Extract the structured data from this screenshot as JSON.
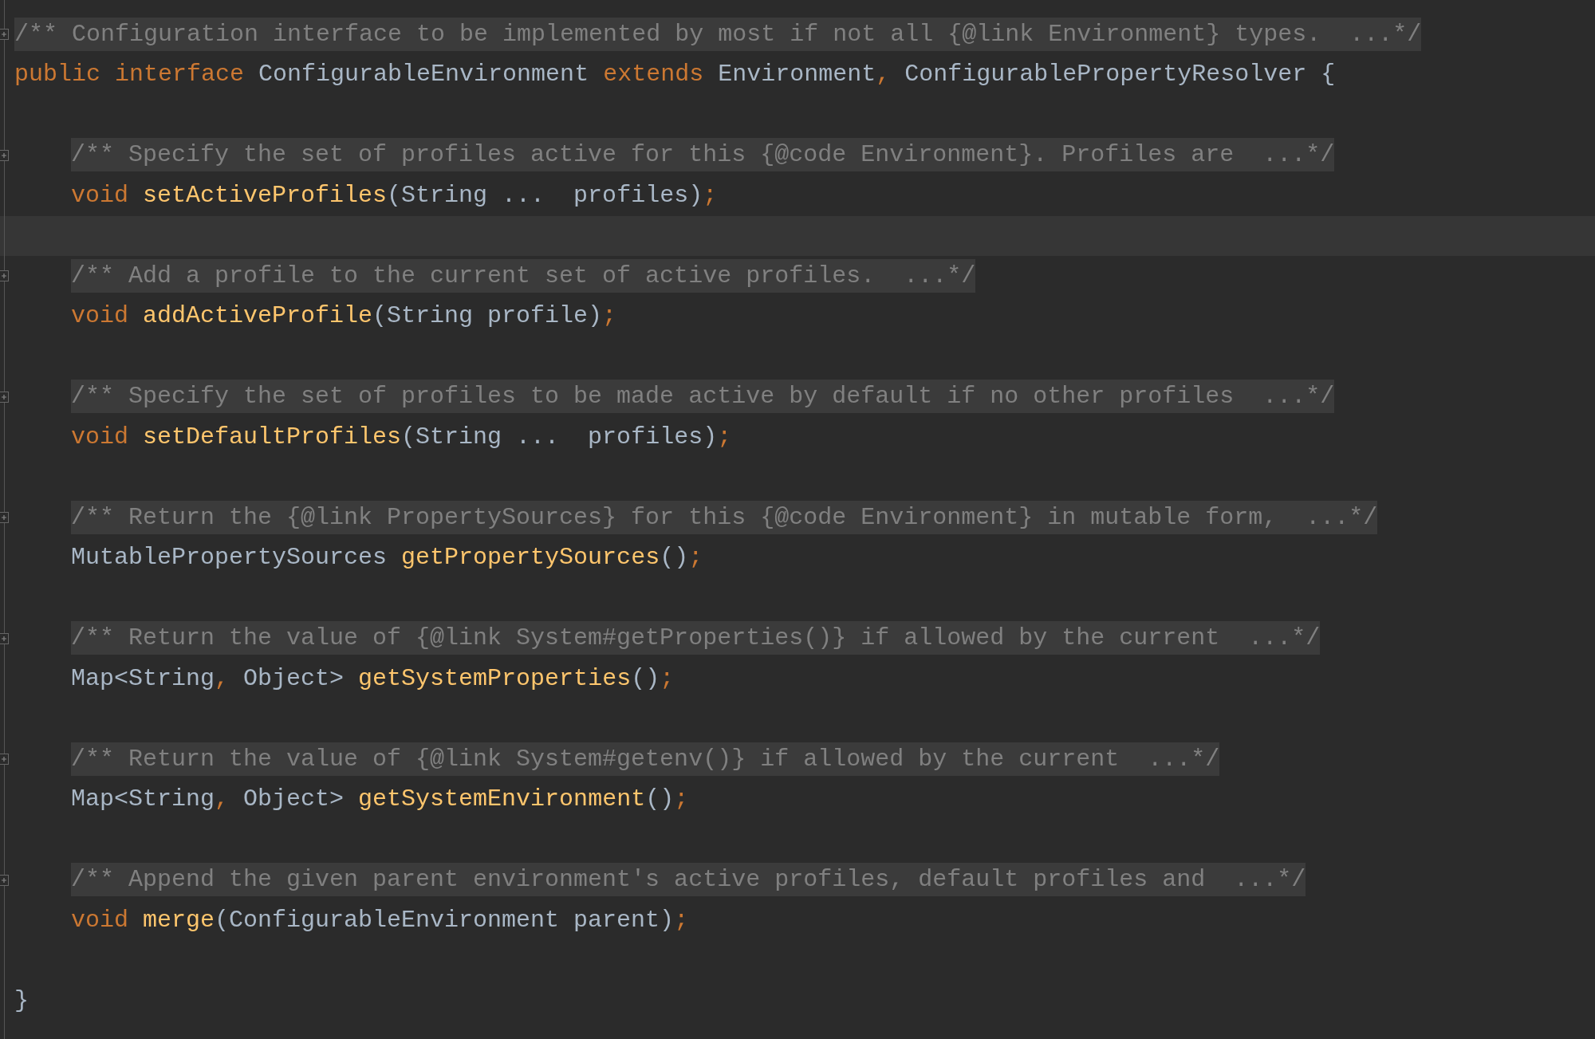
{
  "editor": {
    "header_comment": {
      "text": "/** Configuration interface to be implemented by most if not all {@link Environment} types.  ...*/",
      "folded": true
    },
    "declaration": [
      {
        "kind": "keyword",
        "text": "public interface "
      },
      {
        "kind": "plain",
        "text": "ConfigurableEnvironment "
      },
      {
        "kind": "keyword",
        "text": "extends "
      },
      {
        "kind": "plain",
        "text": "Environment"
      },
      {
        "kind": "punct",
        "text": ", "
      },
      {
        "kind": "plain",
        "text": "ConfigurablePropertyResolver {"
      }
    ],
    "members": [
      {
        "comment": {
          "text": "/** Specify the set of profiles active for this {@code Environment}. Profiles are  ...*/",
          "folded": true
        },
        "signature": [
          {
            "kind": "keyword",
            "text": "void "
          },
          {
            "kind": "method",
            "text": "setActiveProfiles"
          },
          {
            "kind": "plain",
            "text": "(String ...  profiles)"
          },
          {
            "kind": "punct",
            "text": ";"
          }
        ],
        "caret_line_after": true
      },
      {
        "comment": {
          "text": "/** Add a profile to the current set of active profiles.  ...*/",
          "folded": true
        },
        "signature": [
          {
            "kind": "keyword",
            "text": "void "
          },
          {
            "kind": "method",
            "text": "addActiveProfile"
          },
          {
            "kind": "plain",
            "text": "(String profile)"
          },
          {
            "kind": "punct",
            "text": ";"
          }
        ],
        "caret_line_after": false
      },
      {
        "comment": {
          "text": "/** Specify the set of profiles to be made active by default if no other profiles  ...*/",
          "folded": true
        },
        "signature": [
          {
            "kind": "keyword",
            "text": "void "
          },
          {
            "kind": "method",
            "text": "setDefaultProfiles"
          },
          {
            "kind": "plain",
            "text": "(String ...  profiles)"
          },
          {
            "kind": "punct",
            "text": ";"
          }
        ],
        "caret_line_after": false
      },
      {
        "comment": {
          "text": "/** Return the {@link PropertySources} for this {@code Environment} in mutable form,  ...*/",
          "folded": true
        },
        "signature": [
          {
            "kind": "plain",
            "text": "MutablePropertySources "
          },
          {
            "kind": "method",
            "text": "getPropertySources"
          },
          {
            "kind": "plain",
            "text": "()"
          },
          {
            "kind": "punct",
            "text": ";"
          }
        ],
        "caret_line_after": false
      },
      {
        "comment": {
          "text": "/** Return the value of {@link System#getProperties()} if allowed by the current  ...*/",
          "folded": true
        },
        "signature": [
          {
            "kind": "plain",
            "text": "Map<String"
          },
          {
            "kind": "punct",
            "text": ", "
          },
          {
            "kind": "plain",
            "text": "Object> "
          },
          {
            "kind": "method",
            "text": "getSystemProperties"
          },
          {
            "kind": "plain",
            "text": "()"
          },
          {
            "kind": "punct",
            "text": ";"
          }
        ],
        "caret_line_after": false
      },
      {
        "comment": {
          "text": "/** Return the value of {@link System#getenv()} if allowed by the current  ...*/",
          "folded": true
        },
        "signature": [
          {
            "kind": "plain",
            "text": "Map<String"
          },
          {
            "kind": "punct",
            "text": ", "
          },
          {
            "kind": "plain",
            "text": "Object> "
          },
          {
            "kind": "method",
            "text": "getSystemEnvironment"
          },
          {
            "kind": "plain",
            "text": "()"
          },
          {
            "kind": "punct",
            "text": ";"
          }
        ],
        "caret_line_after": false
      },
      {
        "comment": {
          "text": "/** Append the given parent environment's active profiles, default profiles and  ...*/",
          "folded": true
        },
        "signature": [
          {
            "kind": "keyword",
            "text": "void "
          },
          {
            "kind": "method",
            "text": "merge"
          },
          {
            "kind": "plain",
            "text": "(ConfigurableEnvironment parent)"
          },
          {
            "kind": "punct",
            "text": ";"
          }
        ],
        "caret_line_after": false
      }
    ],
    "closing": "}"
  }
}
